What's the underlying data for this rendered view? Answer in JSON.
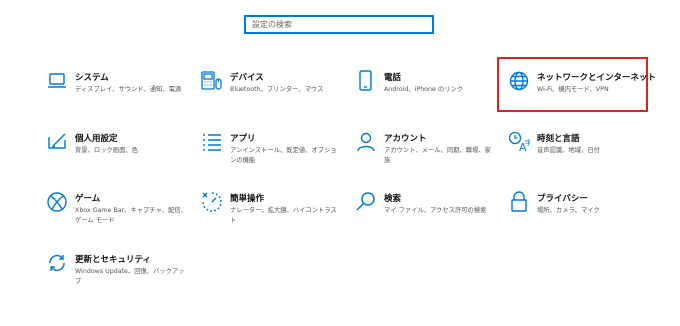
{
  "search": {
    "placeholder": "設定の検索"
  },
  "tiles": [
    {
      "title": "システム",
      "desc": "ディスプレイ、サウンド、通知、電源",
      "icon": "laptop-icon"
    },
    {
      "title": "デバイス",
      "desc": "Bluetooth、プリンター、マウス",
      "icon": "keyboard-icon"
    },
    {
      "title": "電話",
      "desc": "Android、iPhone のリンク",
      "icon": "phone-icon"
    },
    {
      "title": "ネットワークとインターネット",
      "desc": "Wi-Fi、機内モード、VPN",
      "icon": "globe-icon"
    },
    {
      "title": "個人用設定",
      "desc": "背景、ロック画面、色",
      "icon": "personalization-icon"
    },
    {
      "title": "アプリ",
      "desc": "アンインストール、既定値、オプションの機能",
      "icon": "apps-list-icon"
    },
    {
      "title": "アカウント",
      "desc": "アカウント、メール、同期、職場、家族",
      "icon": "person-icon"
    },
    {
      "title": "時刻と言語",
      "desc": "音声認識、地域、日付",
      "icon": "time-language-icon"
    },
    {
      "title": "ゲーム",
      "desc": "Xbox Game Bar、キャプチャ、配信、ゲーム モード",
      "icon": "xbox-icon"
    },
    {
      "title": "簡単操作",
      "desc": "ナレーター、拡大鏡、ハイコントラスト",
      "icon": "ease-of-access-icon"
    },
    {
      "title": "検索",
      "desc": "マイ ファイル、アクセス許可の検索",
      "icon": "search-icon"
    },
    {
      "title": "プライバシー",
      "desc": "場所、カメラ、マイク",
      "icon": "lock-icon"
    },
    {
      "title": "更新とセキュリティ",
      "desc": "Windows Update、回復、バックアップ",
      "icon": "sync-icon"
    }
  ],
  "colors": {
    "accent": "#0078d4",
    "highlight": "#e0201f"
  }
}
